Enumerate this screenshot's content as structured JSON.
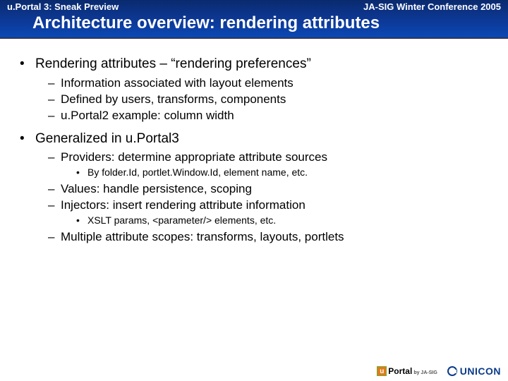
{
  "header": {
    "left": "u.Portal 3: Sneak Preview",
    "right": "JA-SIG Winter Conference 2005",
    "title": "Architecture overview: rendering attributes"
  },
  "bullets": {
    "b1": "Rendering attributes – “rendering preferences”",
    "b1s1": "Information associated with layout elements",
    "b1s2": "Defined by users, transforms, components",
    "b1s3": "u.Portal2 example: column width",
    "b2": "Generalized in u.Portal3",
    "b2s1": "Providers: determine appropriate attribute sources",
    "b2s1a": "By folder.Id, portlet.Window.Id, element name, etc.",
    "b2s2": "Values: handle persistence, scoping",
    "b2s3": "Injectors: insert rendering attribute information",
    "b2s3a": "XSLT params, <parameter/> elements, etc.",
    "b2s4": "Multiple attribute scopes: transforms, layouts, portlets"
  },
  "glyphs": {
    "disc": "•",
    "dash": "–",
    "dot": "•"
  },
  "footer": {
    "uportal_u": "u",
    "uportal_brand": "Portal",
    "uportal_sub": "by JA-SIG",
    "unicon": "UNICON"
  }
}
